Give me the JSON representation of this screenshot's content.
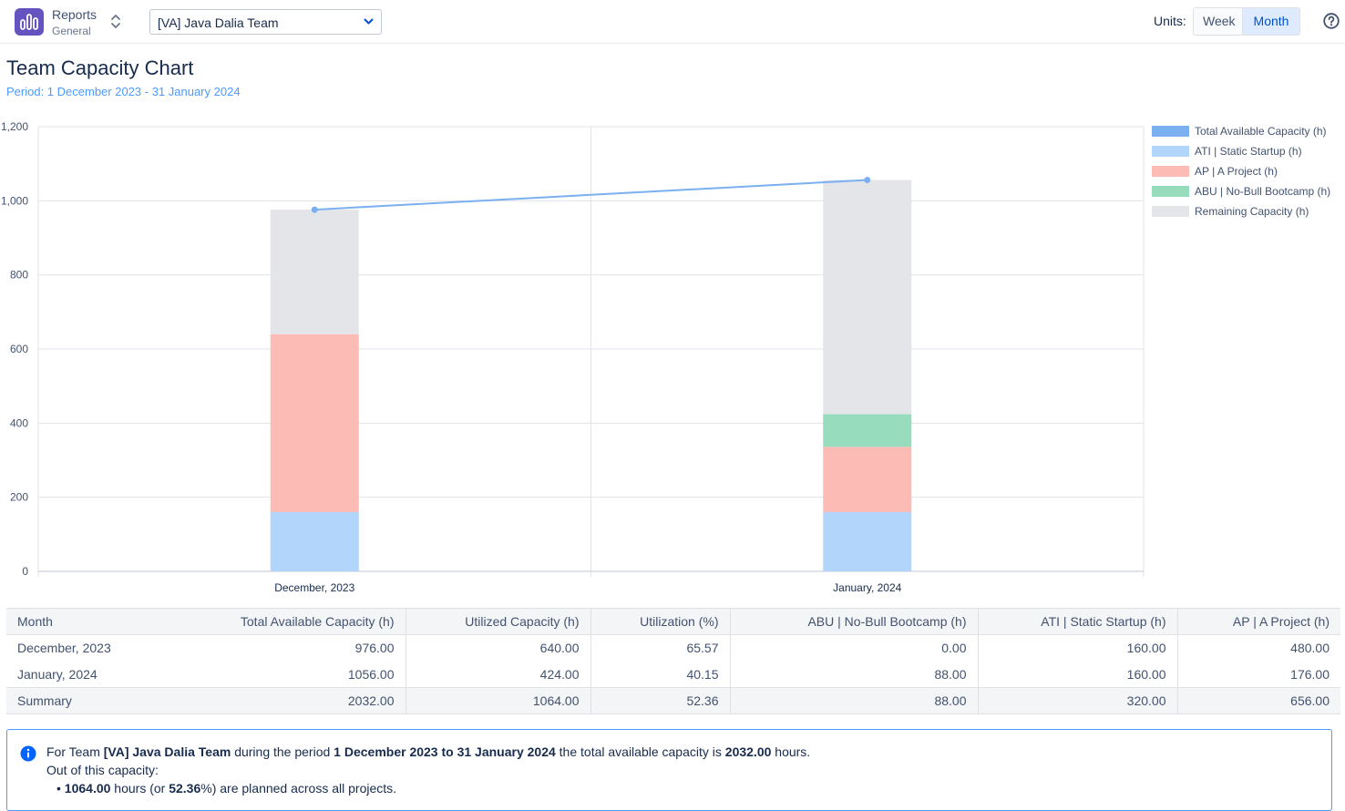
{
  "app": {
    "name": "Reports",
    "section": "General",
    "team_selected": "[VA] Java Dalia Team"
  },
  "units": {
    "label": "Units:",
    "options": [
      "Week",
      "Month"
    ],
    "selected": "Month"
  },
  "page": {
    "title": "Team Capacity Chart",
    "period": "Period: 1 December 2023 - 31 January 2024"
  },
  "colors": {
    "total": "#7ab0f0",
    "ati": "#b1d5fb",
    "ap": "#fdbbb5",
    "abu": "#97ddbd",
    "remaining": "#e4e5e9",
    "accent": "#0052cc",
    "info": "#4c9aff"
  },
  "chart_data": {
    "type": "bar",
    "stacked": true,
    "categories": [
      "December, 2023",
      "January, 2024"
    ],
    "series": [
      {
        "name": "ATI | Static Startup (h)",
        "values": [
          160,
          160
        ],
        "color": "#b1d5fb"
      },
      {
        "name": "AP | A Project (h)",
        "values": [
          480,
          176
        ],
        "color": "#fdbbb5"
      },
      {
        "name": "ABU | No-Bull Bootcamp (h)",
        "values": [
          0,
          88
        ],
        "color": "#97ddbd"
      },
      {
        "name": "Remaining Capacity (h)",
        "values": [
          336,
          632
        ],
        "color": "#e4e5e9"
      }
    ],
    "line_series": {
      "name": "Total Available Capacity (h)",
      "values": [
        976,
        1056
      ],
      "color": "#7ab0f0"
    },
    "legend": [
      "Total Available Capacity (h)",
      "ATI | Static Startup (h)",
      "AP | A Project (h)",
      "ABU | No-Bull Bootcamp (h)",
      "Remaining Capacity (h)"
    ],
    "legend_position": "right",
    "yticks": [
      "0",
      "200",
      "400",
      "600",
      "800",
      "1,000",
      "1,200"
    ],
    "ylim": [
      0,
      1200
    ],
    "grid": true
  },
  "table": {
    "columns": [
      "Month",
      "Total Available Capacity (h)",
      "Utilized Capacity (h)",
      "Utilization (%)",
      "ABU | No-Bull Bootcamp (h)",
      "ATI | Static Startup (h)",
      "AP | A Project (h)"
    ],
    "rows": [
      [
        "December, 2023",
        "976.00",
        "640.00",
        "65.57",
        "0.00",
        "160.00",
        "480.00"
      ],
      [
        "January, 2024",
        "1056.00",
        "424.00",
        "40.15",
        "88.00",
        "160.00",
        "176.00"
      ]
    ],
    "summary": [
      "Summary",
      "2032.00",
      "1064.00",
      "52.36",
      "88.00",
      "320.00",
      "656.00"
    ]
  },
  "info": {
    "l1_a": "For Team ",
    "l1_team": "[VA] Java Dalia Team",
    "l1_b": " during the period ",
    "l1_period": "1 December 2023 to 31 January 2024",
    "l1_c": " the total available capacity is ",
    "l1_total": "2032.00",
    "l1_d": " hours.",
    "l2": "Out of this capacity:",
    "l3_hours": "1064.00",
    "l3_a": " hours (or ",
    "l3_pct": "52.36",
    "l3_b": "%) are planned across all projects."
  }
}
